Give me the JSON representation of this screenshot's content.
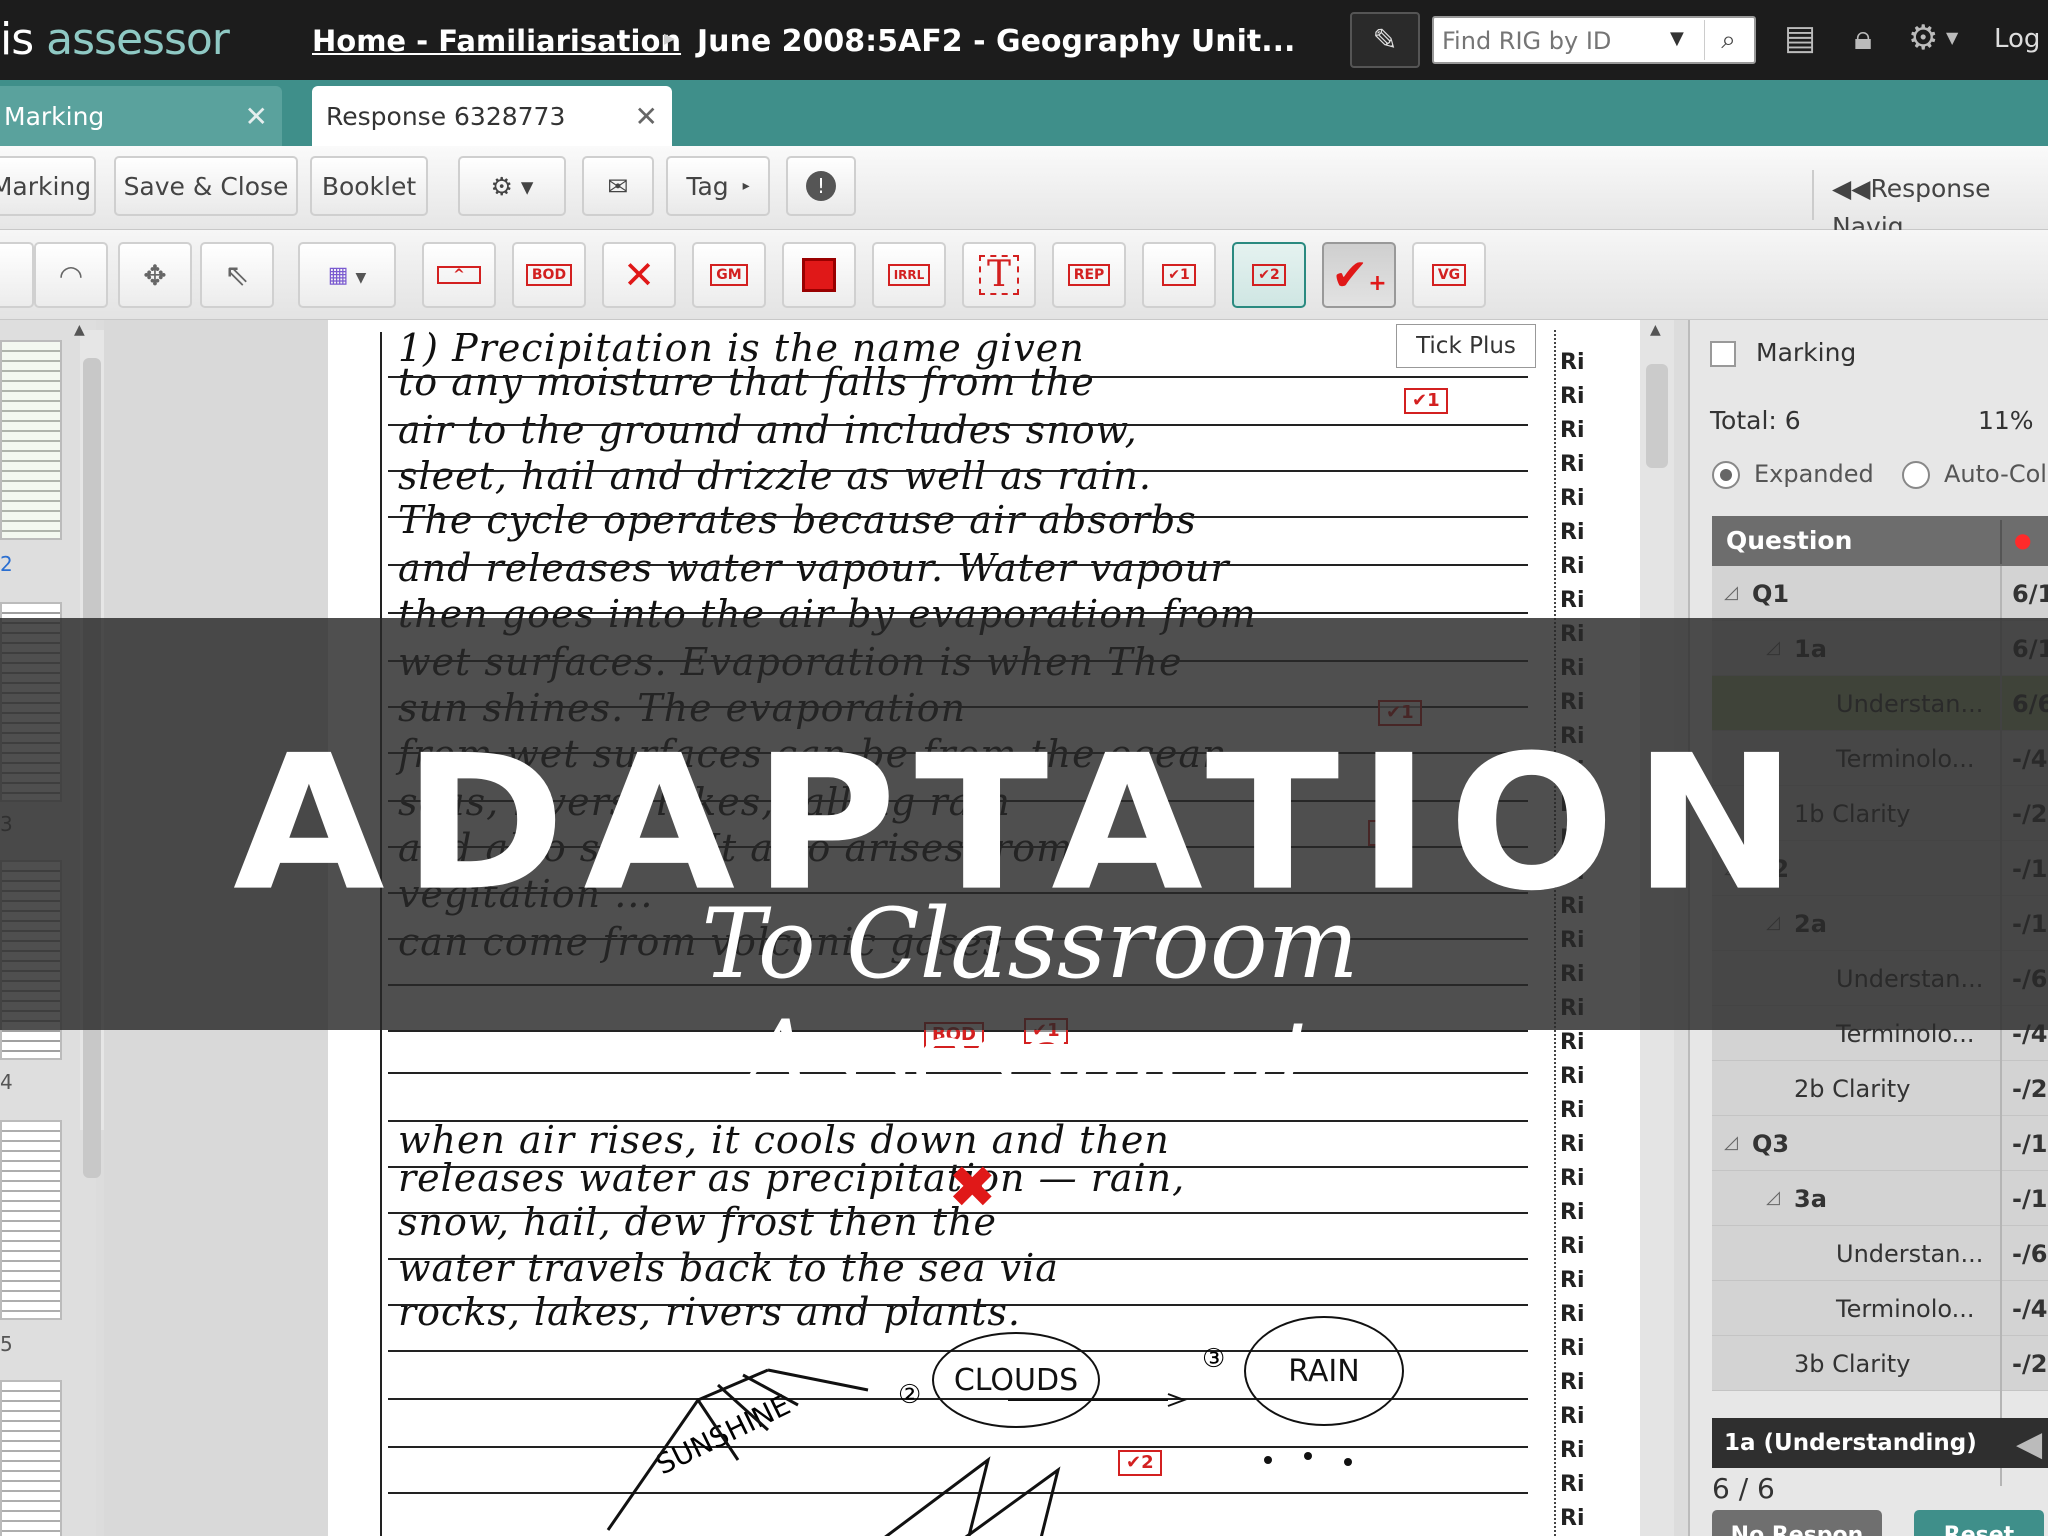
{
  "app": {
    "logo_prefix": "is",
    "logo_name": "assessor"
  },
  "header": {
    "breadcrumb_home": "Home - Familiarisation",
    "breadcrumb_sep": "▸",
    "breadcrumb_current": "June 2008:5AF2 - Geography Unit...",
    "search_placeholder": "Find RIG by ID",
    "logout_label": "Log"
  },
  "tabs": [
    {
      "label": "Marking"
    },
    {
      "label": "Response 6328773"
    }
  ],
  "toolbar": {
    "marking_label": "Marking",
    "save_close_label": "Save & Close",
    "booklet_label": "Booklet",
    "tag_label": "Tag",
    "response_nav_label": "Response Navig"
  },
  "annotations": {
    "stamp_labels": [
      "BOD",
      "GM",
      "IRRL",
      "REP",
      "✔1",
      "✔2",
      "VG"
    ],
    "tooltip": "Tick Plus"
  },
  "document": {
    "lines": [
      "1) Precipitation is the name given",
      "to any moisture that falls from the",
      "air to the ground and includes snow,",
      "sleet, hail and drizzle as well as rain.",
      "The cycle operates because air absorbs",
      "and releases water vapour. Water vapour",
      "then goes into the air by evaporation from",
      "wet surfaces. Evaporation is when The",
      "sun shines. The evaporation",
      "from wet surfaces can be from the ocean",
      "seas, rivers, lakes, falling rain",
      "and also snow. It also arises from",
      "vegitation ...",
      "can come from volcanic gases",
      "when air rises, it cools down and then",
      "releases water as precipitation — rain,",
      "snow, hail, dew frost then the",
      "water travels back to the sea via",
      "rocks, lakes, rivers and plants."
    ],
    "margin_marks": [
      "✔1",
      "✔1",
      "✔1",
      "BOD",
      "✔1",
      "✔2"
    ],
    "rr_label": "Ri",
    "diagram": {
      "sunshine": "SUNSHINE",
      "clouds": "CLOUDS",
      "rain": "RAIN",
      "step2": "②",
      "step3": "③"
    }
  },
  "panel": {
    "title": "Marking",
    "total": "Total: 6",
    "percent": "11%",
    "mode_expanded": "Expanded",
    "mode_auto": "Auto-Col",
    "question_header": "Question",
    "rows": [
      {
        "label": "Q1",
        "value": "6/1",
        "level": 0,
        "tri": "◿"
      },
      {
        "label": "1a",
        "value": "6/1",
        "level": 1,
        "tri": "◿"
      },
      {
        "label": "Understan...",
        "value": "6/6",
        "level": 2,
        "tri": ""
      },
      {
        "label": "Terminolo...",
        "value": "-/4",
        "level": 2,
        "tri": ""
      },
      {
        "label": "1b Clarity",
        "value": "-/2",
        "level": 1,
        "tri": ""
      },
      {
        "label": "Q2",
        "value": "-/1",
        "level": 0,
        "tri": "◿"
      },
      {
        "label": "2a",
        "value": "-/1",
        "level": 1,
        "tri": "◿"
      },
      {
        "label": "Understan...",
        "value": "-/6",
        "level": 2,
        "tri": ""
      },
      {
        "label": "Terminolo...",
        "value": "-/4",
        "level": 2,
        "tri": ""
      },
      {
        "label": "2b Clarity",
        "value": "-/2",
        "level": 1,
        "tri": ""
      },
      {
        "label": "Q3",
        "value": "-/1",
        "level": 0,
        "tri": "◿"
      },
      {
        "label": "3a",
        "value": "-/1",
        "level": 1,
        "tri": "◿"
      },
      {
        "label": "Understan...",
        "value": "-/6",
        "level": 2,
        "tri": ""
      },
      {
        "label": "Terminolo...",
        "value": "-/4",
        "level": 2,
        "tri": ""
      },
      {
        "label": "3b Clarity",
        "value": "-/2",
        "level": 1,
        "tri": ""
      }
    ],
    "selected_item": "1a (Understanding)",
    "selected_score": "6 / 6",
    "no_response_label": "No Respon",
    "reset_label": "Reset"
  },
  "thumbnail_numbers": [
    "3",
    "4",
    "5"
  ],
  "overlay": {
    "title": "ADAPTATION",
    "subtitle": "To Classroom Assessment"
  },
  "colors": {
    "accent_teal": "#3f8f8a",
    "stamp_red": "#d32020",
    "highlight_green": "#a4be84"
  }
}
